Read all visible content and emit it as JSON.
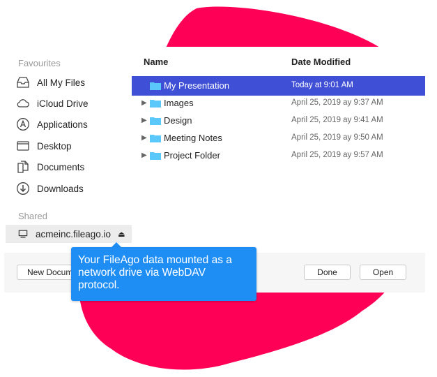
{
  "colors": {
    "blob": "#ff0057",
    "selection": "#3f4fd6",
    "tooltip": "#1e8ef5",
    "folder": "#5ac8fa"
  },
  "sidebar": {
    "favourites_label": "Favourites",
    "items": [
      {
        "label": "All My Files",
        "icon": "all-files-icon"
      },
      {
        "label": "iCloud Drive",
        "icon": "cloud-icon"
      },
      {
        "label": "Applications",
        "icon": "applications-icon"
      },
      {
        "label": "Desktop",
        "icon": "desktop-icon"
      },
      {
        "label": "Documents",
        "icon": "documents-icon"
      },
      {
        "label": "Downloads",
        "icon": "downloads-icon"
      }
    ],
    "shared_label": "Shared",
    "shared_item": {
      "label": "acmeinc.fileago.io",
      "icon": "computer-icon",
      "eject_icon": "eject-icon"
    }
  },
  "list": {
    "columns": {
      "name": "Name",
      "date": "Date Modified"
    },
    "rows": [
      {
        "name": "My Presentation",
        "date": "Today at 9:01 AM",
        "selected": true
      },
      {
        "name": "Images",
        "date": "April 25, 2019 ay 9:37 AM"
      },
      {
        "name": "Design",
        "date": "April 25, 2019 ay 9:41 AM"
      },
      {
        "name": "Meeting Notes",
        "date": "April 25, 2019 ay 9:50 AM"
      },
      {
        "name": "Project Folder",
        "date": "April 25, 2019 ay 9:57 AM"
      }
    ]
  },
  "footer": {
    "new_document": "New Document",
    "done": "Done",
    "open": "Open"
  },
  "tooltip": {
    "text": "Your FileAgo data mounted as a network drive via WebDAV protocol."
  }
}
